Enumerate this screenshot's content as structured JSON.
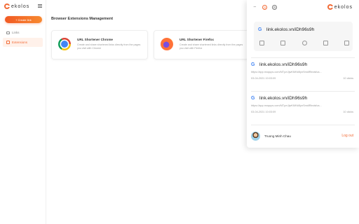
{
  "brand": {
    "name": "ekolos"
  },
  "sidebar": {
    "create_label": "+ Create link",
    "items": [
      {
        "label": "Links",
        "active": false
      },
      {
        "label": "Extensions",
        "active": true
      }
    ]
  },
  "main": {
    "title": "Browser Extensions Management",
    "cards": [
      {
        "name": "URL Shortener Chrome",
        "description": "Create and share shortened links directly from the pages you visit with Chrome"
      },
      {
        "name": "URL Shortener Firefox",
        "description": "Create and share shortened links directly from the pages you visit with Firefox"
      }
    ]
  },
  "popup": {
    "current": {
      "favicon": "G",
      "url": "link.ekolos.vn/iDh96s9h"
    },
    "history": [
      {
        "favicon": "G",
        "url": "link.ekolos.vn/iDh96s9h",
        "long_url": "https://app.moqups.com/MTyvrJjwKMKkBynSmdlRindsfca...",
        "date": "03-04-2021 10:03:09",
        "clicks": "10 clicks"
      },
      {
        "favicon": "G",
        "url": "link.ekolos.vn/iDh96s9h",
        "long_url": "https://app.moqups.com/MTyvrJjwKMKkBynSmdlRindsfca...",
        "date": "03-04-2021 10:03:09",
        "clicks": "10 clicks"
      }
    ],
    "user": {
      "name": "Truong Minh Chau",
      "logout_label": "Log out"
    }
  },
  "colors": {
    "accent": "#f26b36"
  }
}
